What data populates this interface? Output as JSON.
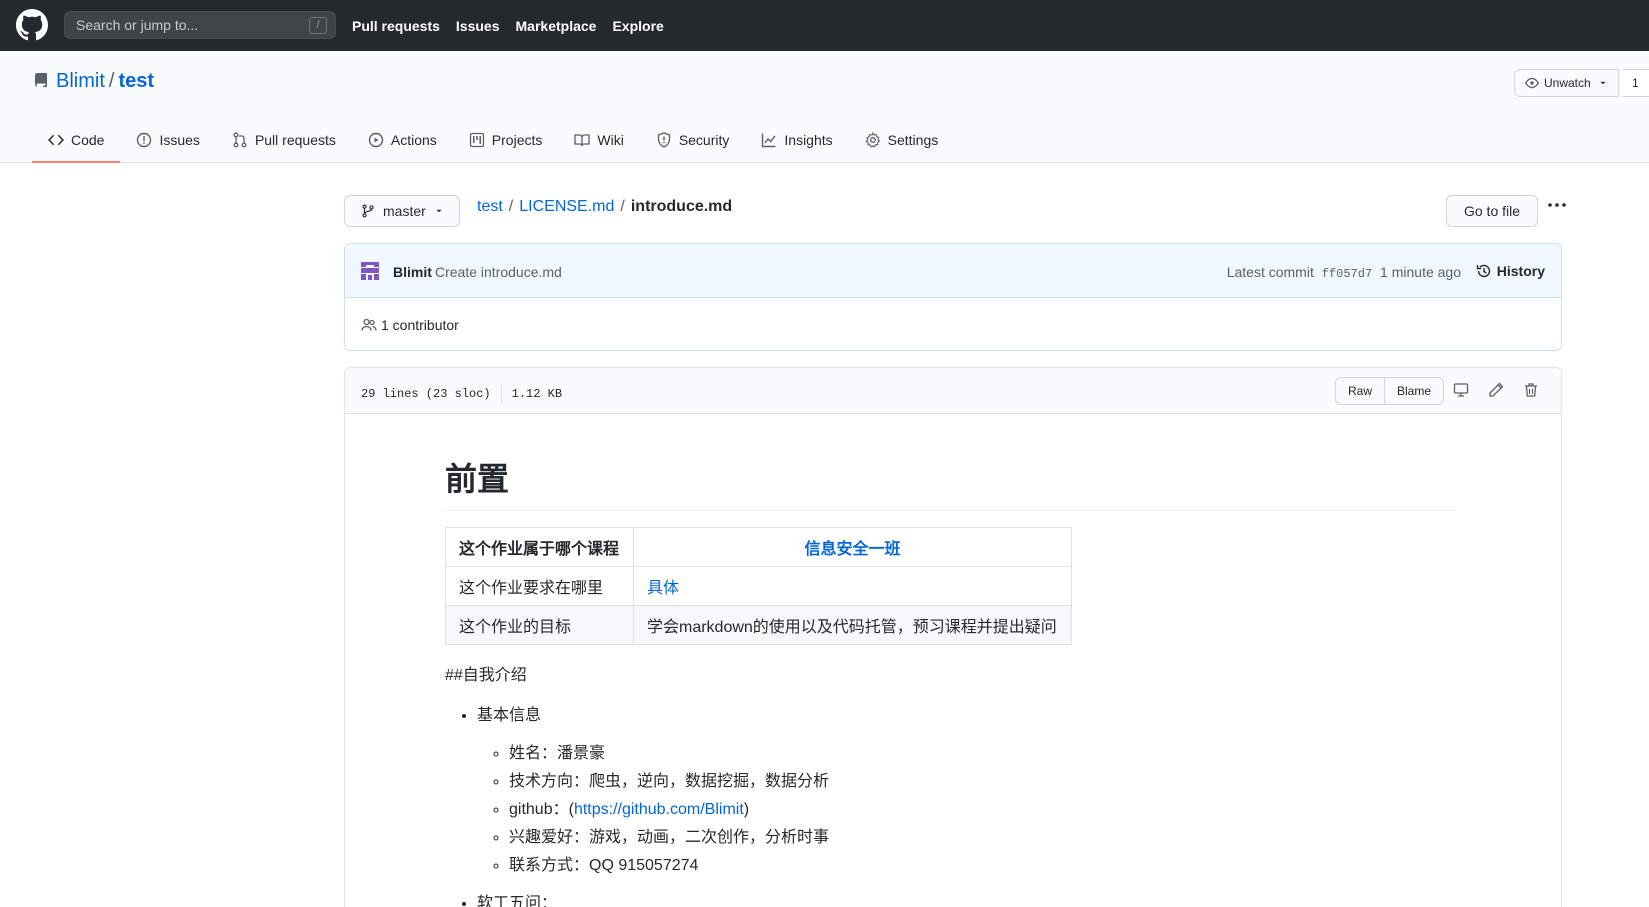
{
  "topbar": {
    "search_placeholder": "Search or jump to...",
    "search_shortcut": "/",
    "nav": [
      "Pull requests",
      "Issues",
      "Marketplace",
      "Explore"
    ]
  },
  "repo": {
    "owner": "Blimit",
    "separator": "/",
    "name": "test",
    "watch_label": "Unwatch",
    "watch_count": "1",
    "tabs": [
      "Code",
      "Issues",
      "Pull requests",
      "Actions",
      "Projects",
      "Wiki",
      "Security",
      "Insights",
      "Settings"
    ]
  },
  "file_nav": {
    "branch": "master",
    "crumbs": [
      "test",
      "LICENSE.md"
    ],
    "current_file": "introduce.md",
    "goto_label": "Go to file"
  },
  "commit": {
    "author": "Blimit",
    "message": "Create introduce.md",
    "latest_label": "Latest commit",
    "sha": "ff057d7",
    "time": "1 minute ago",
    "history_label": "History",
    "contributors": "1 contributor"
  },
  "file": {
    "lines": "29 lines (23 sloc)",
    "size": "1.12 KB",
    "raw_label": "Raw",
    "blame_label": "Blame"
  },
  "markdown": {
    "h1": "前置",
    "table": {
      "header": [
        "这个作业属于哪个课程",
        "信息安全一班"
      ],
      "rows": [
        [
          "这个作业要求在哪里",
          "具体"
        ],
        [
          "这个作业的目标",
          "学会markdown的使用以及代码托管，预习课程并提出疑问"
        ]
      ]
    },
    "intro_heading": "##自我介绍",
    "basic_info": "基本信息",
    "name": "姓名：潘景豪",
    "tech": "技术方向：爬虫，逆向，数据挖掘，数据分析",
    "github_prefix": "github：(",
    "github_link": "https://github.com/Blimit",
    "github_suffix": ")",
    "hobby": "兴趣爱好：游戏，动画，二次创作，分析时事",
    "contact": "联系方式：QQ 915057274",
    "five_questions": "软工五问："
  }
}
